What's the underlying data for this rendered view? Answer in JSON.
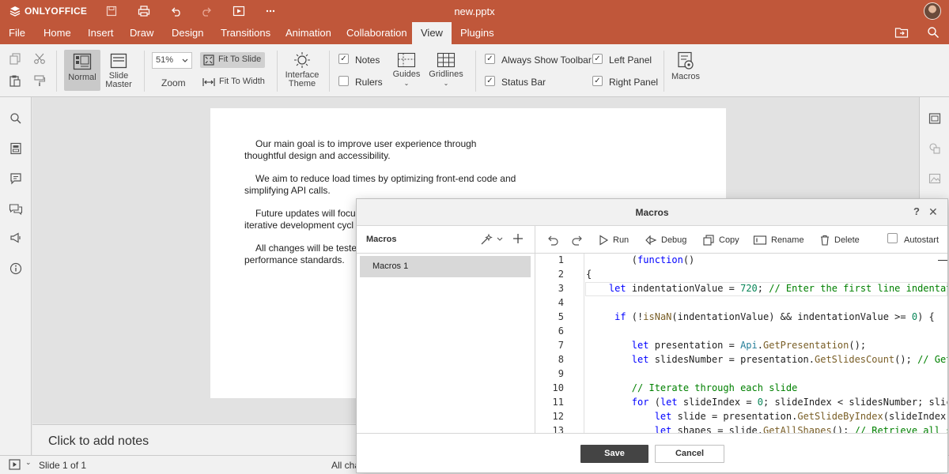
{
  "app": {
    "brand": "ONLYOFFICE",
    "document_title": "new.pptx",
    "accent_color": "#c0573a"
  },
  "quick_access": [
    "save-icon",
    "print-icon",
    "undo-icon",
    "redo-icon",
    "start-slideshow-icon",
    "more-icon"
  ],
  "menu": {
    "tabs": [
      "File",
      "Home",
      "Insert",
      "Draw",
      "Design",
      "Transitions",
      "Animation",
      "Collaboration",
      "View",
      "Plugins"
    ],
    "active": "View"
  },
  "toolbar": {
    "normal_label": "Normal",
    "slide_master_label": "Slide Master",
    "zoom_value": "51%",
    "zoom_label": "Zoom",
    "fit_to_slide": "Fit To Slide",
    "fit_to_width": "Fit To Width",
    "interface_theme": "Interface Theme",
    "notes_label": "Notes",
    "rulers_label": "Rulers",
    "guides_label": "Guides",
    "gridlines_label": "Gridlines",
    "always_show_toolbar": "Always Show Toolbar",
    "status_bar": "Status Bar",
    "left_panel": "Left Panel",
    "right_panel": "Right Panel",
    "macros_label": "Macros"
  },
  "slide": {
    "paragraphs": [
      [
        "Our main goal is to improve user experience through",
        "thoughtful design and accessibility."
      ],
      [
        "We aim to reduce load times by optimizing front-end code and",
        "simplifying API calls."
      ],
      [
        "Future updates will focu",
        "iterative development cycl"
      ],
      [
        "All changes will be teste",
        "performance standards."
      ]
    ]
  },
  "notes_placeholder": "Click to add notes",
  "status": {
    "slide_counter": "Slide 1 of 1",
    "right_text": "All cha"
  },
  "dialog": {
    "title": "Macros",
    "help": "?",
    "close": "✕",
    "list_header": "Macros",
    "macros": [
      "Macros 1"
    ],
    "buttons": {
      "run": "Run",
      "debug": "Debug",
      "copy": "Copy",
      "rename": "Rename",
      "delete": "Delete",
      "autostart": "Autostart"
    },
    "save": "Save",
    "cancel": "Cancel"
  },
  "code": {
    "line_numbers": [
      "1",
      "2",
      "3",
      "4",
      "5",
      "6",
      "7",
      "8",
      "9",
      "10",
      "11",
      "12",
      "13"
    ],
    "lines": [
      "        (function()",
      "{",
      "    let indentationValue = 720; // Enter the first line indentat",
      "",
      "     if (!isNaN(indentationValue) && indentationValue >= 0) {",
      "",
      "        let presentation = Api.GetPresentation();",
      "        let slidesNumber = presentation.GetSlidesCount(); // Get",
      "",
      "        // Iterate through each slide",
      "        for (let slideIndex = 0; slideIndex < slidesNumber; slic",
      "            let slide = presentation.GetSlideByIndex(slideIndex)",
      "            let shapes = slide.GetAllShapes(); // Retrieve all s"
    ]
  }
}
